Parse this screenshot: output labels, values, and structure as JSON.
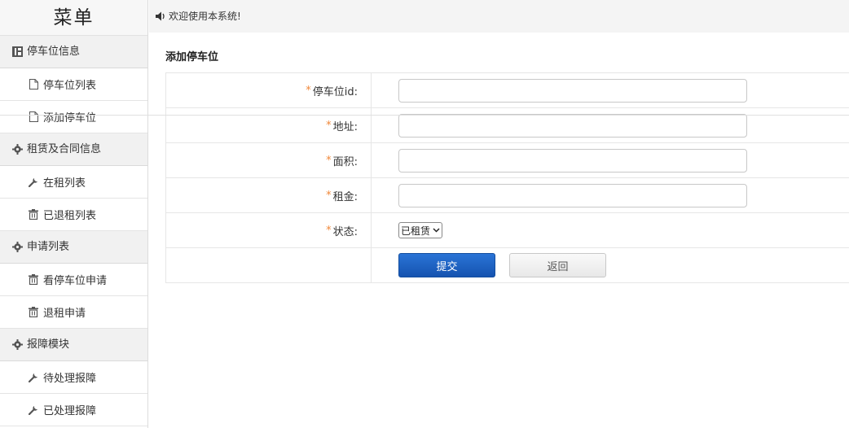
{
  "sidebar": {
    "title": "菜单",
    "groups": [
      {
        "label": "停车位信息",
        "icon": "grid-icon",
        "items": [
          {
            "label": "停车位列表",
            "icon": "file-icon"
          },
          {
            "label": "添加停车位",
            "icon": "file-icon"
          }
        ]
      },
      {
        "label": "租赁及合同信息",
        "icon": "gear-icon",
        "items": [
          {
            "label": "在租列表",
            "icon": "wrench-icon"
          },
          {
            "label": "已退租列表",
            "icon": "trash-icon"
          }
        ]
      },
      {
        "label": "申请列表",
        "icon": "gear-icon",
        "items": [
          {
            "label": "看停车位申请",
            "icon": "trash-icon"
          },
          {
            "label": "退租申请",
            "icon": "trash-icon"
          }
        ]
      },
      {
        "label": "报障模块",
        "icon": "gear-icon",
        "items": [
          {
            "label": "待处理报障",
            "icon": "wrench-icon"
          },
          {
            "label": "已处理报障",
            "icon": "wrench-icon"
          }
        ]
      }
    ]
  },
  "topbar": {
    "welcome": "欢迎使用本系统!",
    "icon": "speaker-icon"
  },
  "form": {
    "title": "添加停车位",
    "required_mark": "*",
    "fields": {
      "parking_id": {
        "label": "停车位id:",
        "value": ""
      },
      "address": {
        "label": "地址:",
        "value": ""
      },
      "area": {
        "label": "面积:",
        "value": ""
      },
      "rent": {
        "label": "租金:",
        "value": ""
      },
      "status": {
        "label": "状态:",
        "selected": "已租赁"
      }
    },
    "submit_label": "提交",
    "back_label": "返回"
  },
  "colors": {
    "primary_button": "#1a5fc1",
    "required": "#f0883a"
  }
}
